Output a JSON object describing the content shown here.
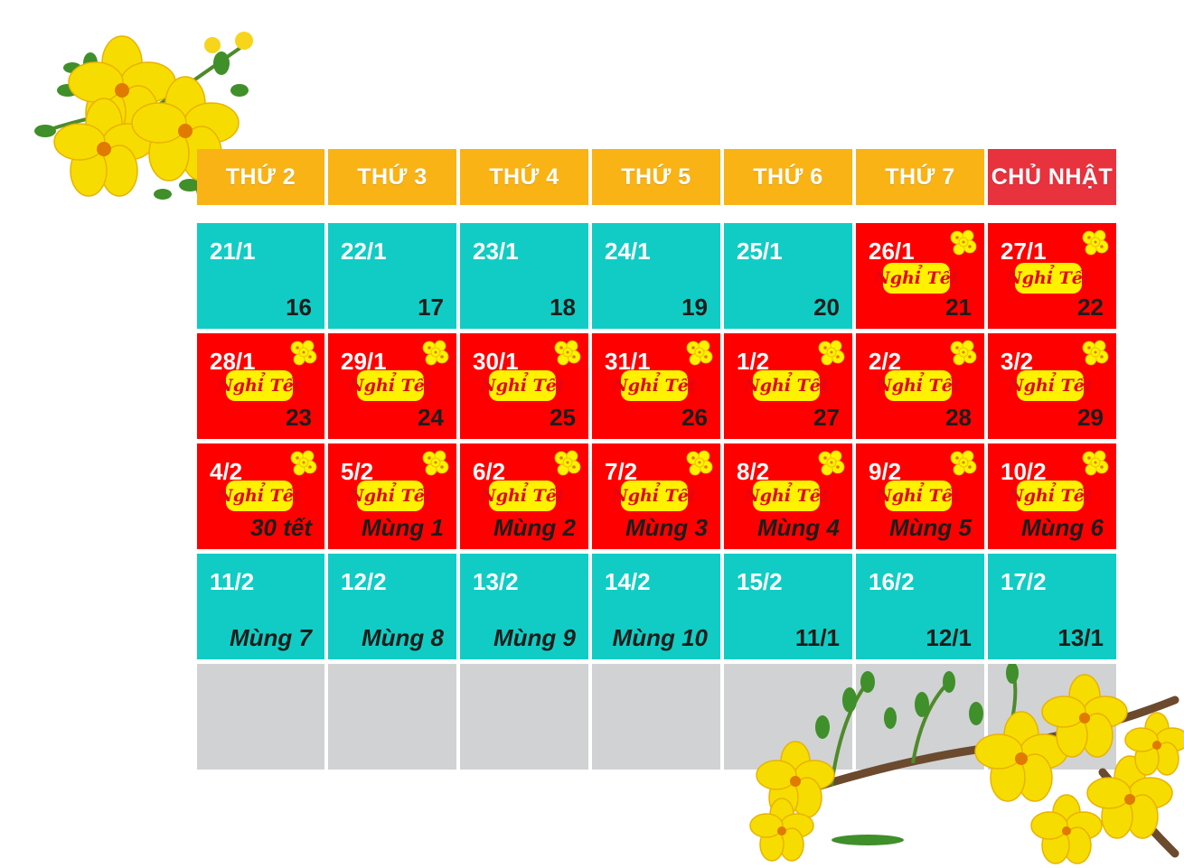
{
  "weekdays": [
    {
      "label": "THỨ 2",
      "color": "#f9b314"
    },
    {
      "label": "THỨ 3",
      "color": "#f9b314"
    },
    {
      "label": "THỨ 4",
      "color": "#f9b314"
    },
    {
      "label": "THỨ 5",
      "color": "#f9b314"
    },
    {
      "label": "THỨ 6",
      "color": "#f9b314"
    },
    {
      "label": "THỨ 7",
      "color": "#f9b314"
    },
    {
      "label": "CHỦ NHẬT",
      "color": "#e8323d"
    }
  ],
  "holiday_label": "Nghỉ Tết",
  "colors": {
    "workday": "#11ccc4",
    "holiday": "#ff0000",
    "empty": "#d1d2d4",
    "badge": "#fff200"
  },
  "weeks": [
    [
      {
        "date": "21/1",
        "lunar": "16",
        "holiday": false
      },
      {
        "date": "22/1",
        "lunar": "17",
        "holiday": false
      },
      {
        "date": "23/1",
        "lunar": "18",
        "holiday": false
      },
      {
        "date": "24/1",
        "lunar": "19",
        "holiday": false
      },
      {
        "date": "25/1",
        "lunar": "20",
        "holiday": false
      },
      {
        "date": "26/1",
        "lunar": "21",
        "holiday": true
      },
      {
        "date": "27/1",
        "lunar": "22",
        "holiday": true
      }
    ],
    [
      {
        "date": "28/1",
        "lunar": "23",
        "holiday": true
      },
      {
        "date": "29/1",
        "lunar": "24",
        "holiday": true
      },
      {
        "date": "30/1",
        "lunar": "25",
        "holiday": true
      },
      {
        "date": "31/1",
        "lunar": "26",
        "holiday": true
      },
      {
        "date": "1/2",
        "lunar": "27",
        "holiday": true
      },
      {
        "date": "2/2",
        "lunar": "28",
        "holiday": true
      },
      {
        "date": "3/2",
        "lunar": "29",
        "holiday": true
      }
    ],
    [
      {
        "date": "4/2",
        "lunar": "30 tết",
        "holiday": true
      },
      {
        "date": "5/2",
        "lunar": "Mùng 1",
        "holiday": true
      },
      {
        "date": "6/2",
        "lunar": "Mùng 2",
        "holiday": true
      },
      {
        "date": "7/2",
        "lunar": "Mùng 3",
        "holiday": true
      },
      {
        "date": "8/2",
        "lunar": "Mùng 4",
        "holiday": true
      },
      {
        "date": "9/2",
        "lunar": "Mùng 5",
        "holiday": true
      },
      {
        "date": "10/2",
        "lunar": "Mùng 6",
        "holiday": true
      }
    ],
    [
      {
        "date": "11/2",
        "lunar": "Mùng 7",
        "holiday": false
      },
      {
        "date": "12/2",
        "lunar": "Mùng 8",
        "holiday": false
      },
      {
        "date": "13/2",
        "lunar": "Mùng 9",
        "holiday": false
      },
      {
        "date": "14/2",
        "lunar": "Mùng 10",
        "holiday": false
      },
      {
        "date": "15/2",
        "lunar": "11/1",
        "holiday": false
      },
      {
        "date": "16/2",
        "lunar": "12/1",
        "holiday": false
      },
      {
        "date": "17/2",
        "lunar": "13/1",
        "holiday": false
      }
    ],
    [
      {
        "date": "",
        "lunar": "",
        "holiday": false,
        "empty": true
      },
      {
        "date": "",
        "lunar": "",
        "holiday": false,
        "empty": true
      },
      {
        "date": "",
        "lunar": "",
        "holiday": false,
        "empty": true
      },
      {
        "date": "",
        "lunar": "",
        "holiday": false,
        "empty": true
      },
      {
        "date": "",
        "lunar": "",
        "holiday": false,
        "empty": true
      },
      {
        "date": "",
        "lunar": "",
        "holiday": false,
        "empty": true
      },
      {
        "date": "",
        "lunar": "",
        "holiday": false,
        "empty": true
      }
    ]
  ],
  "decorations": {
    "top_left": "apricot-blossom",
    "bottom_right": "apricot-blossom-branch",
    "cell_icon": "apricot-flower-icon"
  }
}
